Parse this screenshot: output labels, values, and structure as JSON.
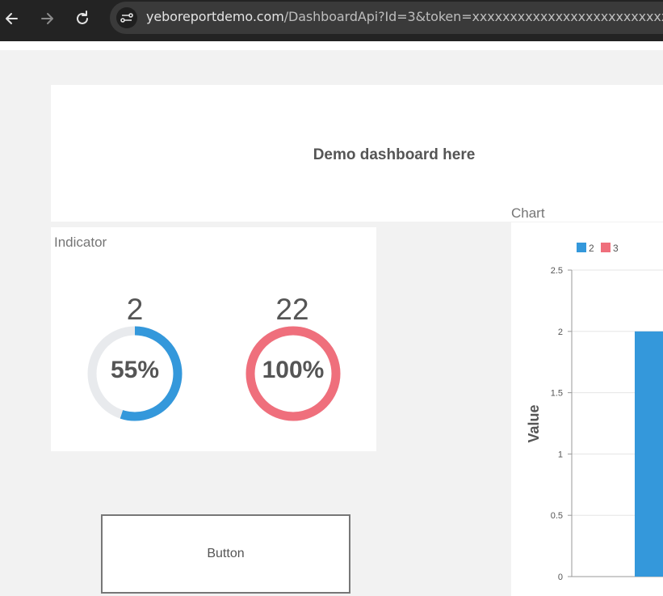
{
  "browser": {
    "url_host": "yeboreportdemo.com",
    "url_path": "/DashboardApi?Id=3&token=xxxxxxxxxxxxxxxxxxxxxxxxxxxxxxxxx"
  },
  "dashboard": {
    "title": "Demo dashboard here"
  },
  "indicator": {
    "label": "Indicator",
    "items": [
      {
        "value": "2",
        "percent_label": "55%",
        "fraction": 0.55,
        "color": "#3498db",
        "track_color": "#e8eaed"
      },
      {
        "value": "22",
        "percent_label": "100%",
        "fraction": 1.0,
        "color": "#ef6f7c",
        "track_color": "#e8eaed"
      }
    ]
  },
  "button": {
    "label": "Button"
  },
  "chart_data": {
    "type": "bar",
    "title": "Chart",
    "ylabel": "Value",
    "ylim": [
      0,
      2.5
    ],
    "yticks": [
      "0",
      "0.5",
      "1",
      "1.5",
      "2",
      "2.5"
    ],
    "legend_position": "top-left",
    "series": [
      {
        "name": "2",
        "color": "#3498db",
        "values": [
          2
        ]
      },
      {
        "name": "3",
        "color": "#ef6f7c",
        "values": []
      }
    ],
    "grid": true
  }
}
